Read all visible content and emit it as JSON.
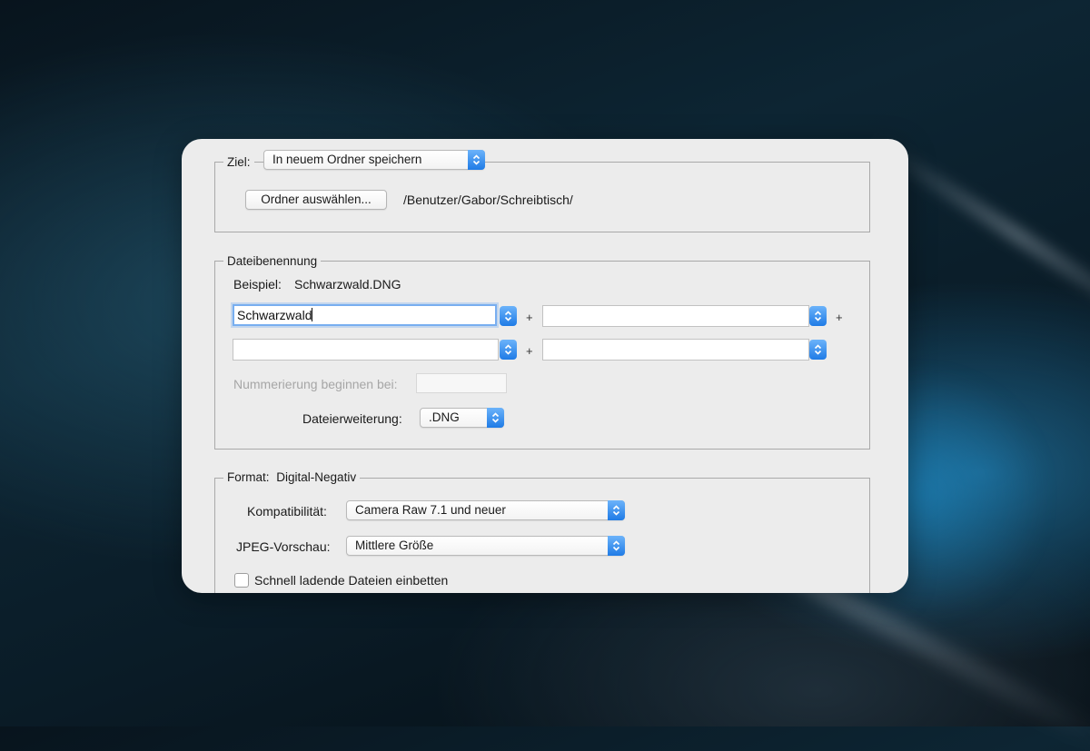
{
  "ziel": {
    "label": "Ziel:",
    "destination_value": "In neuem Ordner speichern",
    "choose_folder_button": "Ordner auswählen...",
    "path": "/Benutzer/Gabor/Schreibtisch/"
  },
  "naming": {
    "title": "Dateibenennung",
    "example_label": "Beispiel:",
    "example_value": "Schwarzwald.DNG",
    "fields": [
      "Schwarzwald",
      "",
      "",
      ""
    ],
    "plus": "+",
    "numbering_label": "Nummerierung beginnen bei:",
    "numbering_value": "",
    "extension_label": "Dateierweiterung:",
    "extension_value": ".DNG"
  },
  "format": {
    "label": "Format:",
    "value": "Digital-Negativ",
    "compat_label": "Kompatibilität:",
    "compat_value": "Camera Raw 7.1 und neuer",
    "jpeg_label": "JPEG-Vorschau:",
    "jpeg_value": "Mittlere Größe",
    "embed_checkbox_label": "Schnell ladende Dateien einbetten",
    "embed_checked": false
  },
  "colors": {
    "accent": "#1f7be6",
    "dialog_bg": "#ececec",
    "focus_ring": "#78aef0"
  }
}
